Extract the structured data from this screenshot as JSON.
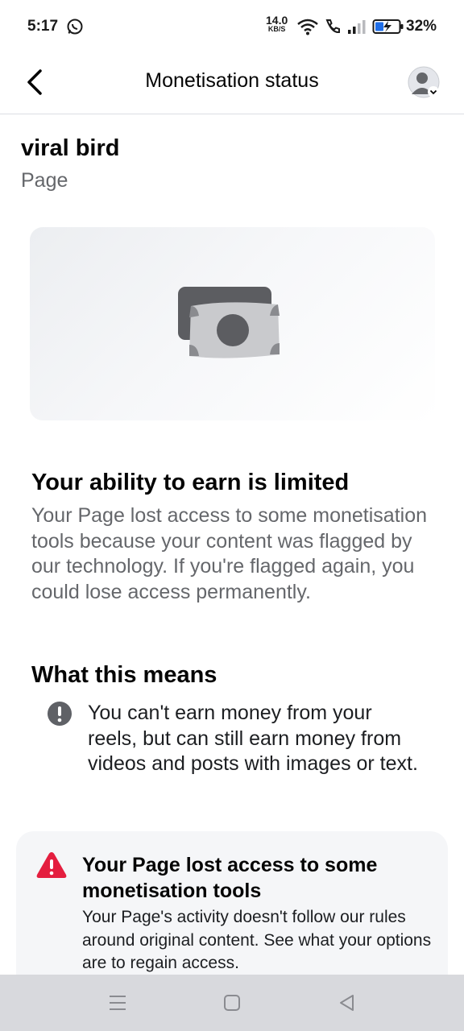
{
  "status_bar": {
    "time": "5:17",
    "net_speed": "14.0",
    "net_unit": "KB/S",
    "battery": "32%"
  },
  "header": {
    "title": "Monetisation status",
    "back_icon": "chevron-left-icon",
    "avatar_icon": "profile-avatar-icon"
  },
  "page": {
    "name": "viral bird",
    "type": "Page"
  },
  "status": {
    "title": "Your ability to earn is limited",
    "description": "Your Page lost access to some monetisation tools because your content was flagged by our technology. If you're flagged again, you could lose access permanently."
  },
  "means": {
    "title": "What this means",
    "items": [
      {
        "icon": "exclamation-circle-icon",
        "text": "You can't earn money from your reels, but can still earn money from videos and posts with images or text."
      }
    ]
  },
  "warning": {
    "icon": "warning-triangle-icon",
    "title": "Your Page lost access to some monetisation tools",
    "description": "Your Page's activity doesn't follow our rules around original content. See what your options are to regain access."
  },
  "colors": {
    "warning_red": "#e41e3f",
    "secondary_text": "#65676b",
    "card_bg": "#f5f6f8"
  }
}
